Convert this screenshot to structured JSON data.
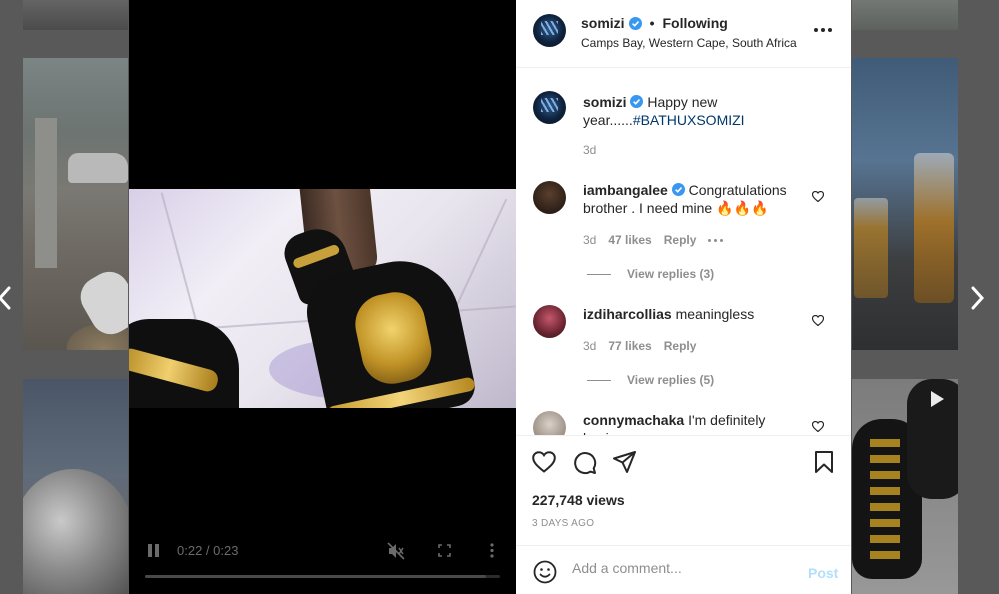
{
  "post": {
    "username": "somizi",
    "follow_state": "Following",
    "separator": "•",
    "location": "Camps Bay, Western Cape, South Africa",
    "caption_text": "Happy new year......",
    "caption_hashtag": "#BATHUXSOMIZI",
    "caption_age": "3d",
    "views": "227,748 views",
    "date": "3 DAYS AGO"
  },
  "video": {
    "time": "0:22 / 0:23",
    "progress": 0.96
  },
  "comments": [
    {
      "username": "iambangalee",
      "verified": true,
      "text": "Congratulations brother . I need mine 🔥🔥🔥",
      "age": "3d",
      "likes": "47 likes",
      "reply_label": "Reply",
      "view_replies": "View replies (3)"
    },
    {
      "username": "izdiharcollias",
      "verified": false,
      "text": "meaningless",
      "age": "3d",
      "likes": "77 likes",
      "reply_label": "Reply",
      "view_replies": "View replies (5)"
    },
    {
      "username": "connymachaka",
      "verified": false,
      "text": "I'm definitely buying"
    }
  ],
  "comment_box": {
    "placeholder": "Add a comment...",
    "post_label": "Post"
  },
  "colors": {
    "verified": "#3897f0",
    "hashtag": "#00376b",
    "post_button": "#b2dffc"
  },
  "icons": {
    "heart": "heart-icon",
    "comment": "comment-icon",
    "share": "share-icon",
    "save": "bookmark-icon",
    "emoji": "emoji-icon"
  }
}
